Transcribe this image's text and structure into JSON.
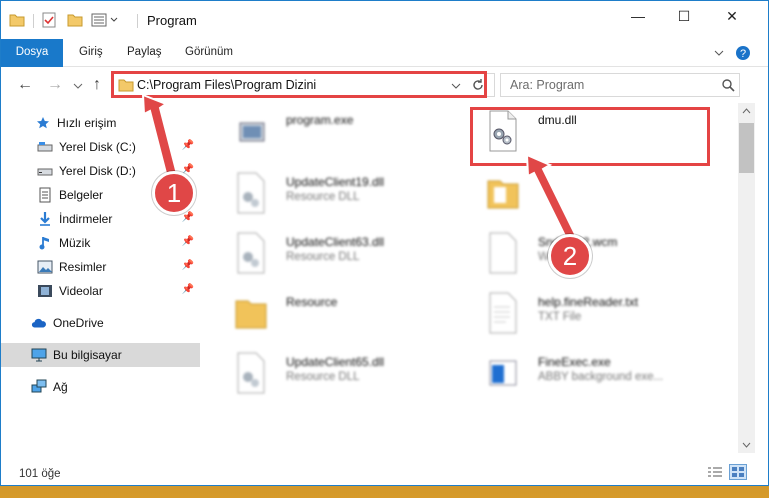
{
  "window": {
    "title": "Program",
    "controls": {
      "minimize": "—",
      "maximize": "☐",
      "close": "✕"
    }
  },
  "ribbon": {
    "tabs": [
      "Dosya",
      "Giriş",
      "Paylaş",
      "Görünüm"
    ]
  },
  "address": {
    "path": "C:\\Program Files\\Program Dizini"
  },
  "search": {
    "placeholder": "Ara: Program"
  },
  "sidebar": {
    "items": [
      {
        "label": "Hızlı erişim",
        "icon": "star-icon"
      },
      {
        "label": "Yerel Disk (C:)",
        "icon": "drive-icon",
        "pinned": true
      },
      {
        "label": "Yerel Disk (D:)",
        "icon": "drive-icon",
        "pinned": true
      },
      {
        "label": "Belgeler",
        "icon": "documents-icon",
        "pinned": true
      },
      {
        "label": "İndirmeler",
        "icon": "download-icon",
        "pinned": true
      },
      {
        "label": "Müzik",
        "icon": "music-icon",
        "pinned": true
      },
      {
        "label": "Resimler",
        "icon": "pictures-icon",
        "pinned": true
      },
      {
        "label": "Videolar",
        "icon": "videos-icon",
        "pinned": true
      },
      {
        "label": "OneDrive",
        "icon": "cloud-icon"
      },
      {
        "label": "Bu bilgisayar",
        "icon": "computer-icon",
        "selected": true
      },
      {
        "label": "Ağ",
        "icon": "network-icon"
      }
    ]
  },
  "files": [
    {
      "name": "program.exe",
      "sub": "",
      "icon": "exe-icon"
    },
    {
      "name": "dmu.dll",
      "sub": "",
      "icon": "dll-gear-icon"
    },
    {
      "name": "UpdateClient19.dll",
      "sub": "Resource DLL",
      "icon": "dll-gear-icon"
    },
    {
      "name": "",
      "sub": "",
      "icon": "folder-icon"
    },
    {
      "name": "UpdateClient63.dll",
      "sub": "Resource DLL",
      "icon": "dll-gear-icon"
    },
    {
      "name": "Snd1...02.wcm",
      "sub": "WCM",
      "icon": "file-icon"
    },
    {
      "name": "Resource",
      "sub": "",
      "icon": "folder-icon"
    },
    {
      "name": "help.fineReader.txt",
      "sub": "TXT File",
      "icon": "text-file-icon"
    },
    {
      "name": "UpdateClient65.dll",
      "sub": "Resource DLL",
      "icon": "dll-gear-icon"
    },
    {
      "name": "FineExec.exe",
      "sub": "ABBY background exe...",
      "icon": "exe-icon"
    }
  ],
  "status": {
    "item_count": "101 öğe"
  },
  "callouts": [
    "1",
    "2"
  ],
  "colors": {
    "accent": "#1979ca",
    "highlight": "#e44444"
  }
}
